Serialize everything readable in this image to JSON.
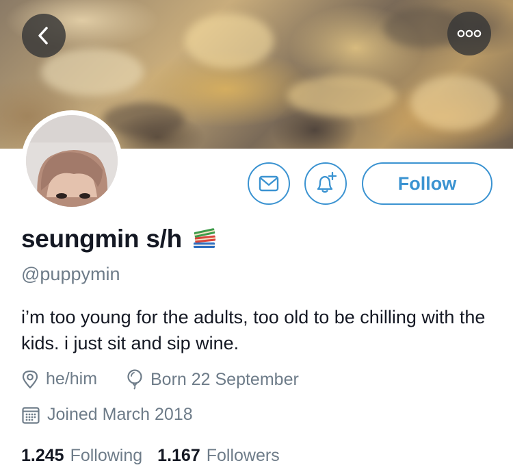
{
  "header": {
    "back_icon": "chevron-left-icon",
    "more_icon": "ellipsis-icon"
  },
  "profile": {
    "display_name": "seungmin s/h",
    "name_emoji": "books-icon",
    "handle": "@puppymin",
    "bio": "i’m too young for the adults, too old to be chilling with the kids. i just sit and sip wine.",
    "pronouns": "he/him",
    "birthday": "Born 22 September",
    "joined": "Joined March 2018"
  },
  "actions": {
    "message_icon": "envelope-icon",
    "notify_icon": "bell-plus-icon",
    "follow_label": "Follow"
  },
  "stats": {
    "following_count": "1.245",
    "following_label": "Following",
    "followers_count": "1.167",
    "followers_label": "Followers"
  },
  "colors": {
    "accent": "#3b93d1",
    "text_primary": "#141823",
    "text_secondary": "#6e7c89"
  }
}
